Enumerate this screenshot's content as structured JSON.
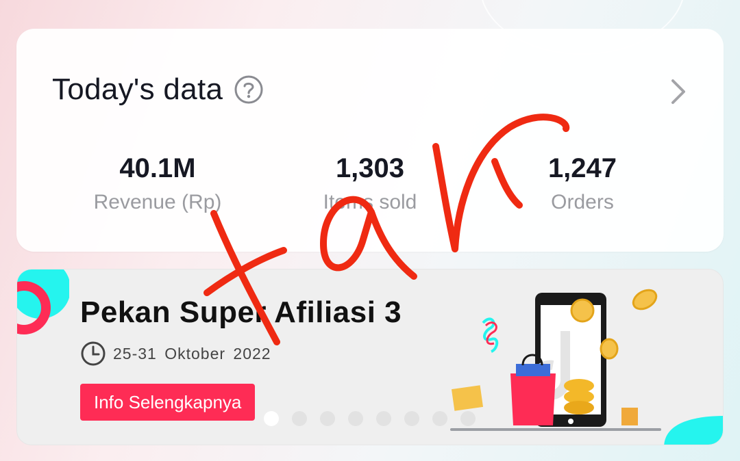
{
  "today_data": {
    "title": "Today's data",
    "stats": [
      {
        "value": "40.1M",
        "label": "Revenue (Rp)"
      },
      {
        "value": "1,303",
        "label": "Items sold"
      },
      {
        "value": "1,247",
        "label": "Orders"
      }
    ],
    "icons": {
      "help": "question-circle-icon",
      "more": "chevron-right-icon"
    }
  },
  "banner": {
    "title": "Pekan Super Afiliasi 3",
    "date": "25-31 Oktober 2022",
    "button_label": "Info Selengkapnya",
    "carousel_dots": 8,
    "active_dot": 1
  },
  "handwriting": "xan",
  "colors": {
    "accent": "#fe2c55",
    "teal": "#25f4ee",
    "scribble": "#ef2a12"
  }
}
